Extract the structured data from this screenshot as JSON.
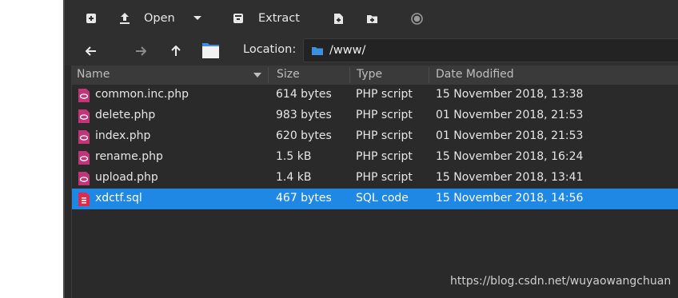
{
  "toolbar": {
    "open_label": "Open",
    "extract_label": "Extract"
  },
  "locationbar": {
    "label": "Location:",
    "path": "/www/"
  },
  "table": {
    "headers": {
      "name": "Name",
      "size": "Size",
      "type": "Type",
      "date": "Date Modified"
    },
    "rows": [
      {
        "name": "common.inc.php",
        "size": "614 bytes",
        "type": "PHP script",
        "date": "15 November 2018, 13:38",
        "icon": "php-file-icon"
      },
      {
        "name": "delete.php",
        "size": "983 bytes",
        "type": "PHP script",
        "date": "01 November 2018, 21:53",
        "icon": "php-file-icon"
      },
      {
        "name": "index.php",
        "size": "620 bytes",
        "type": "PHP script",
        "date": "01 November 2018, 21:53",
        "icon": "php-file-icon"
      },
      {
        "name": "rename.php",
        "size": "1.5 kB",
        "type": "PHP script",
        "date": "15 November 2018, 16:24",
        "icon": "php-file-icon"
      },
      {
        "name": "upload.php",
        "size": "1.4 kB",
        "type": "PHP script",
        "date": "15 November 2018, 13:41",
        "icon": "php-file-icon"
      },
      {
        "name": "xdctf.sql",
        "size": "467 bytes",
        "type": "SQL code",
        "date": "15 November 2018, 14:56",
        "icon": "sql-file-icon",
        "selected": true
      }
    ]
  },
  "watermark": "https://blog.csdn.net/wuyaowangchuan",
  "colors": {
    "selection": "#1f88e5",
    "php_icon": "#c2357a",
    "sql_icon": "#e0284a",
    "folder": "#3d8fe0"
  }
}
